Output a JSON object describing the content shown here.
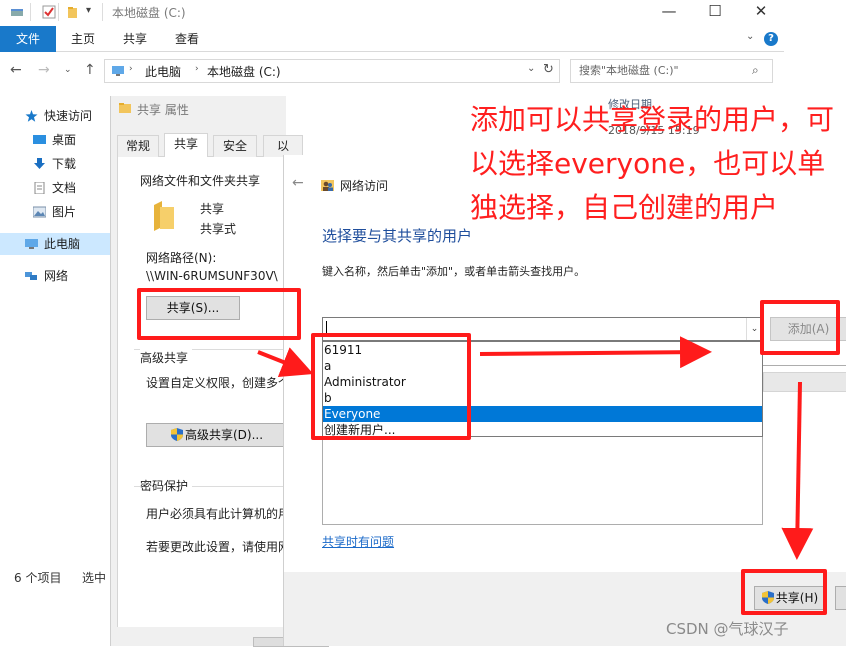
{
  "window": {
    "title": "本地磁盘 (C:)",
    "controls": {
      "minimize": "—",
      "maximize": "☐",
      "close": "✕"
    }
  },
  "ribbon": {
    "tabs": [
      "文件",
      "主页",
      "共享",
      "查看"
    ],
    "help": "?"
  },
  "address": {
    "path": [
      "此电脑",
      "本地磁盘 (C:)"
    ],
    "search_placeholder": "搜索\"本地磁盘 (C:)\""
  },
  "nav": {
    "items": [
      "快速访问",
      "桌面",
      "下载",
      "文档",
      "图片",
      "此电脑",
      "网络"
    ]
  },
  "status": {
    "count": "6 个项目",
    "selected": "选中"
  },
  "filelist": {
    "column_modified": "修改日期",
    "date_value": "2018/9/15 15:19"
  },
  "properties": {
    "title": "共享 属性",
    "tabs": [
      "常规",
      "共享",
      "安全",
      "以"
    ],
    "net_files_header": "网络文件和文件夹共享",
    "folder_name": "共享",
    "folder_state": "共享式",
    "network_path_label": "网络路径(N):",
    "network_path_value": "\\\\WIN-6RUMSUNF30V\\",
    "share_button": "共享(S)...",
    "advanced_header": "高级共享",
    "advanced_desc": "设置自定义权限，创建多个",
    "advanced_button": "高级共享(D)...",
    "password_header": "密码保护",
    "password_desc1": "用户必须具有此计算机的用",
    "password_desc2": "若要更改此设置，请使用网"
  },
  "network_access": {
    "title": "网络访问",
    "heading": "选择要与其共享的用户",
    "instruction": "键入名称，然后单击\"添加\"，或者单击箭头查找用户。",
    "combo_value": "",
    "add_button": "添加(A)",
    "dropdown_options": [
      "61911",
      "a",
      "Administrator",
      "b",
      "Everyone",
      "创建新用户..."
    ],
    "selected_option": "Everyone",
    "trouble_link": "共享时有问题",
    "share_button": "共享(H)"
  },
  "annotation": {
    "text": "添加可以共享登录的用户，可以选择everyone，也可以单独选择，自己创建的用户",
    "color": "#ff1f1f"
  },
  "watermark": "CSDN @气球汉子"
}
